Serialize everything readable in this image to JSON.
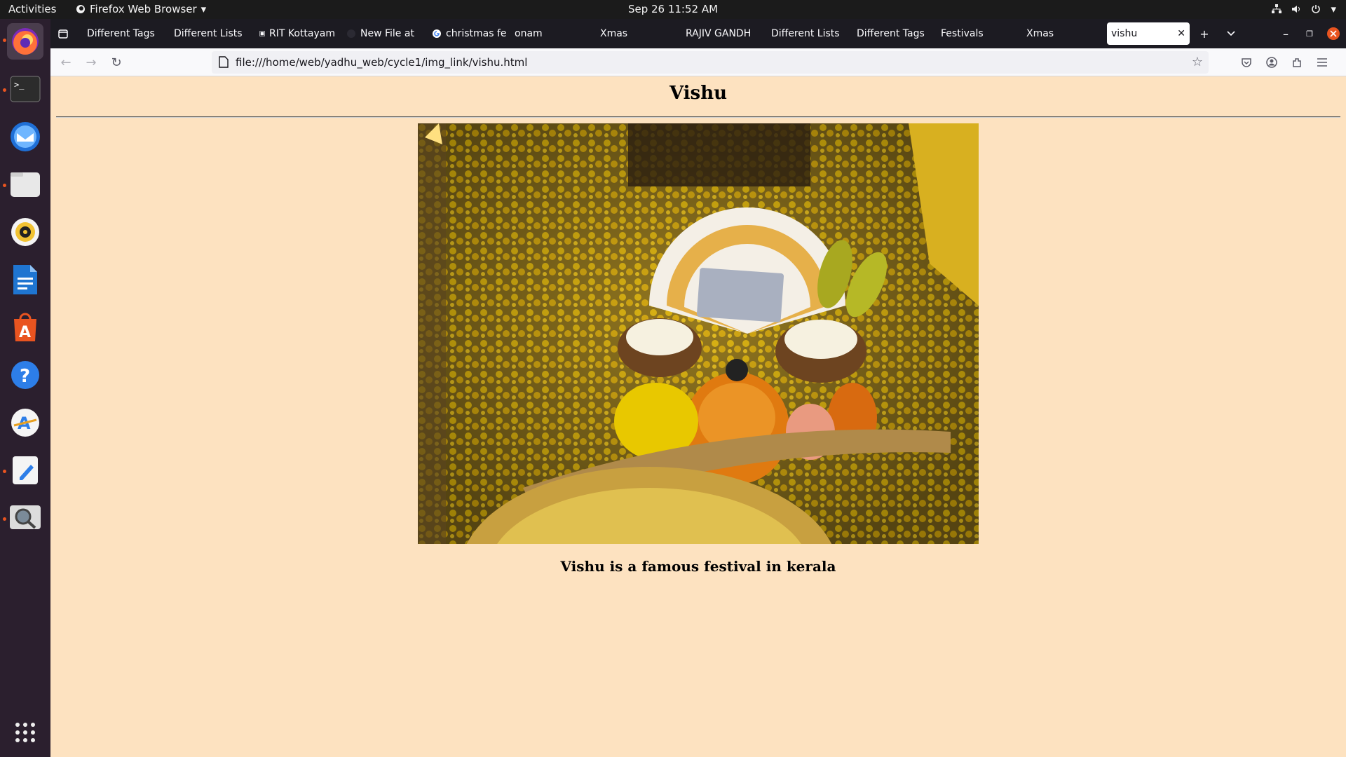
{
  "topbar": {
    "activities": "Activities",
    "app_name": "Firefox Web Browser",
    "clock": "Sep 26  11:52 AM"
  },
  "browser": {
    "tabs": [
      {
        "label": "Different Tags"
      },
      {
        "label": "Different Lists"
      },
      {
        "label": "RIT Kottayam"
      },
      {
        "label": "New File at"
      },
      {
        "label": "christmas fe"
      },
      {
        "label": "onam"
      },
      {
        "label": "Xmas"
      },
      {
        "label": "RAJIV GANDHI"
      },
      {
        "label": "Different Lists"
      },
      {
        "label": "Different Tags"
      },
      {
        "label": "Festivals"
      },
      {
        "label": "Xmas"
      },
      {
        "label": "vishu"
      }
    ],
    "url": "file:///home/web/yadhu_web/cycle1/img_link/vishu.html"
  },
  "page": {
    "title": "Vishu",
    "caption": "Vishu is a famous festival in kerala"
  },
  "dock": {
    "items": [
      "firefox-icon",
      "terminal-icon",
      "thunderbird-icon",
      "files-icon",
      "rhythmbox-icon",
      "writer-icon",
      "app-center-icon",
      "help-icon",
      "software-icon",
      "text-editor-icon",
      "search-tool-icon",
      "show-apps-icon"
    ]
  },
  "colors": {
    "page_background": "#fde2c0",
    "topbar": "#1b1b1b",
    "dock": "#2b1f2e",
    "tabbar": "#1c1b22",
    "accent": "#e95420"
  }
}
